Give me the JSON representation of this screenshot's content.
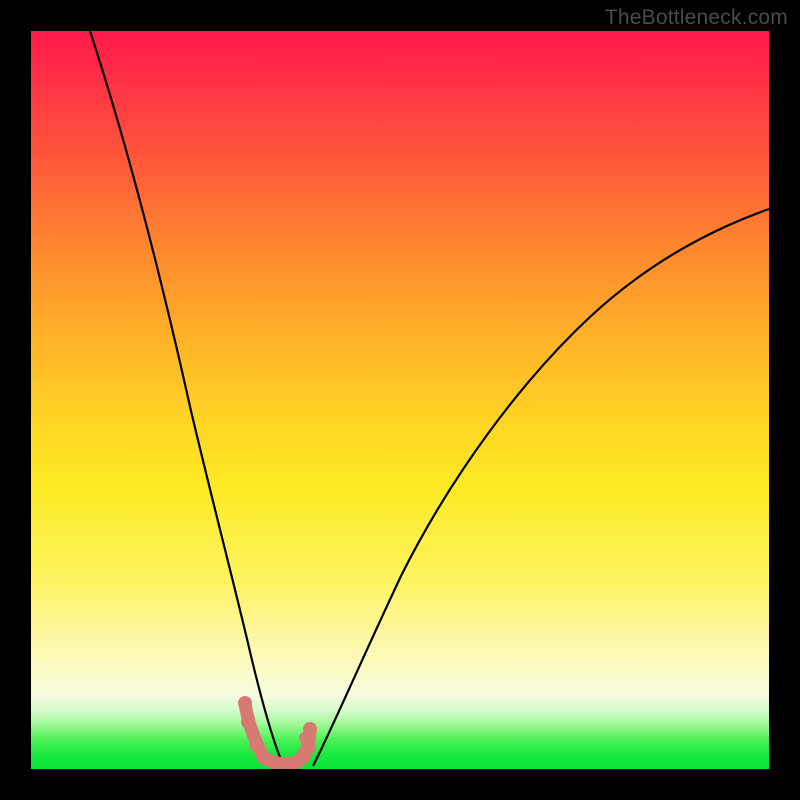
{
  "watermark": "TheBottleneck.com",
  "chart_data": {
    "type": "line",
    "title": "",
    "xlabel": "",
    "ylabel": "",
    "xlim": [
      0,
      100
    ],
    "ylim": [
      0,
      100
    ],
    "grid": false,
    "legend": false,
    "annotations": [],
    "series": [
      {
        "name": "left-curve",
        "x": [
          8,
          12,
          16,
          20,
          23,
          25,
          27,
          29,
          30,
          31,
          32,
          33,
          34
        ],
        "y": [
          100,
          83,
          66,
          48,
          33,
          23,
          15,
          8,
          5,
          3,
          1.5,
          0.7,
          0.3
        ]
      },
      {
        "name": "right-curve",
        "x": [
          38,
          40,
          43,
          47,
          52,
          58,
          65,
          73,
          82,
          92,
          100
        ],
        "y": [
          0.3,
          1.5,
          5,
          12,
          21,
          32,
          43,
          53,
          62,
          70,
          76
        ]
      },
      {
        "name": "bottom-dots",
        "x": [
          29.0,
          29.5,
          30.5,
          31.5,
          33.0,
          34.5,
          36.0,
          37.0,
          37.6,
          37.8,
          36.8,
          37.2
        ],
        "y": [
          8.5,
          6.0,
          2.8,
          1.0,
          0.5,
          0.5,
          0.8,
          1.4,
          2.6,
          5.2,
          1.0,
          3.8
        ]
      }
    ],
    "colors": {
      "curve": "#000000",
      "dots": "#d77a73"
    }
  }
}
